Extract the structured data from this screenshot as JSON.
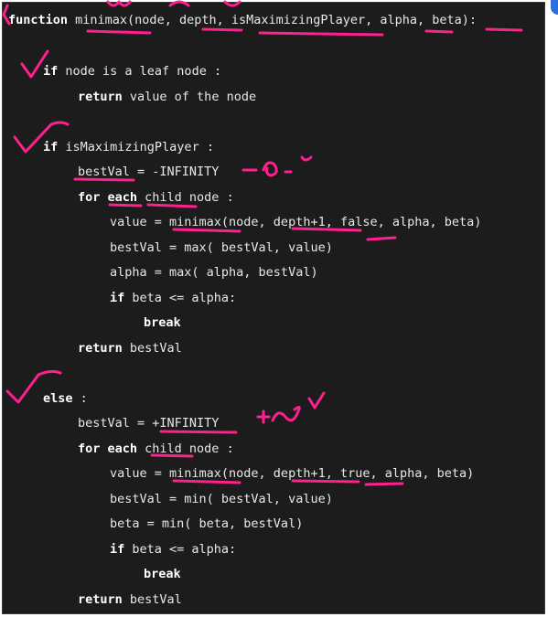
{
  "code": {
    "line_01": {
      "kw": "function",
      "text": " minimax(node, depth, isMaximizingPlayer, alpha, beta):"
    },
    "line_02": {
      "kw": "if",
      "text": " node is a leaf node :"
    },
    "line_03": {
      "kw": "return",
      "text": " value of the node"
    },
    "line_04": {
      "kw": "if",
      "text": " isMaximizingPlayer :"
    },
    "line_05": {
      "text": "bestVal = -INFINITY"
    },
    "line_06": {
      "kw": "for each",
      "text": " child node :"
    },
    "line_07": {
      "text": "value = minimax(node, depth+1, false, alpha, beta)"
    },
    "line_08": {
      "text": "bestVal = max( bestVal, value)"
    },
    "line_09": {
      "text": "alpha = max( alpha, bestVal)"
    },
    "line_10": {
      "kw": "if",
      "text": " beta <= alpha:"
    },
    "line_11": {
      "kw": "break",
      "text": ""
    },
    "line_12": {
      "kw": "return",
      "text": " bestVal"
    },
    "line_13": {
      "kw": "else",
      "text": " :"
    },
    "line_14": {
      "text": "bestVal = +INFINITY"
    },
    "line_15": {
      "kw": "for each",
      "text": " child node :"
    },
    "line_16": {
      "text": "value = minimax(node, depth+1, true, alpha, beta)"
    },
    "line_17": {
      "text": "bestVal = min( bestVal, value)"
    },
    "line_18": {
      "text": "beta = min( beta, bestVal)"
    },
    "line_19": {
      "kw": "if",
      "text": " beta <= alpha:"
    },
    "line_20": {
      "kw": "break",
      "text": ""
    },
    "line_21": {
      "kw": "return",
      "text": " bestVal"
    }
  },
  "colors": {
    "background": "#1c1c1c",
    "text": "#e8e8e8",
    "annotation": "#ff1f8e"
  }
}
